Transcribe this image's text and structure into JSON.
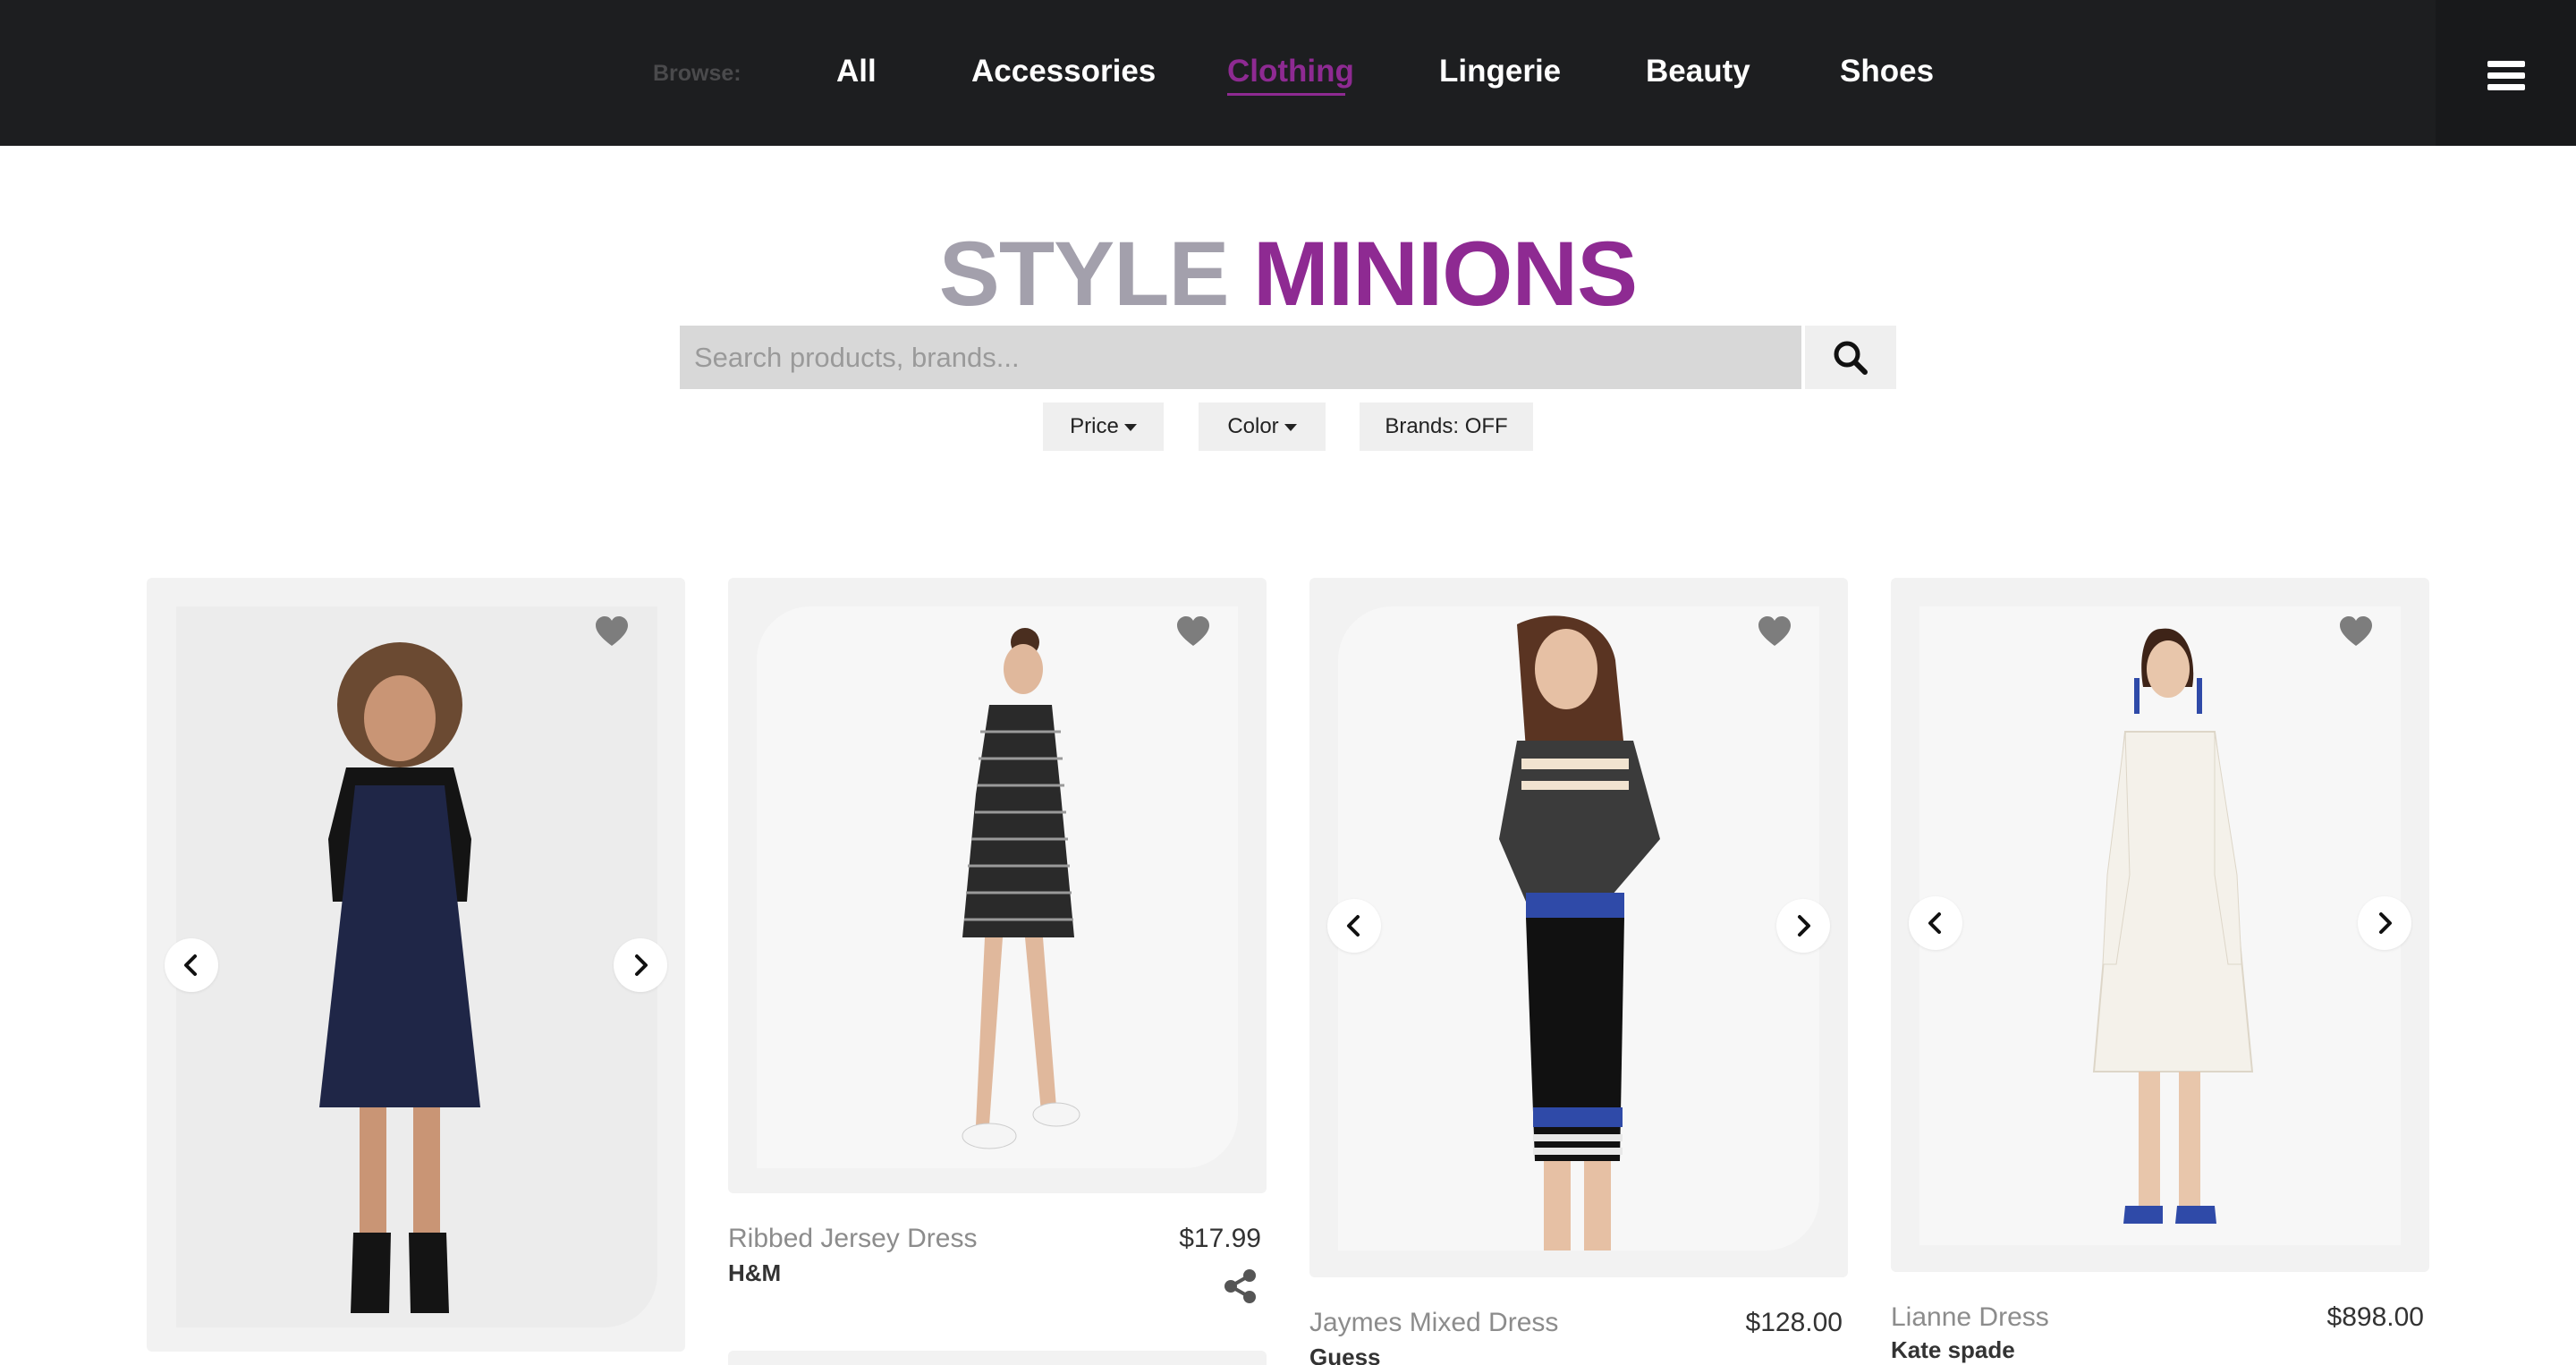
{
  "nav": {
    "browse_label": "Browse:",
    "links": [
      {
        "label": "All"
      },
      {
        "label": "Accessories"
      },
      {
        "label": "Clothing",
        "active": true
      },
      {
        "label": "Lingerie"
      },
      {
        "label": "Beauty"
      },
      {
        "label": "Shoes"
      }
    ],
    "menu_icon": "hamburger-menu-icon"
  },
  "logo": {
    "part1": "STYLE",
    "part2": "MINIONS"
  },
  "search": {
    "placeholder": "Search products, brands...",
    "value": "",
    "icon": "search-icon"
  },
  "filters": [
    {
      "label": "Price",
      "has_dropdown": true
    },
    {
      "label": "Color",
      "has_dropdown": true
    },
    {
      "label": "Brands: OFF",
      "has_dropdown": false
    }
  ],
  "products": [
    {
      "name": "",
      "brand": "",
      "price": ""
    },
    {
      "name": "Ribbed Jersey Dress",
      "brand": "H&M",
      "price": "$17.99"
    },
    {
      "name": "Jaymes Mixed Dress",
      "brand": "Guess",
      "price": "$128.00"
    },
    {
      "name": "Lianne Dress",
      "brand": "Kate spade",
      "price": "$898.00"
    }
  ],
  "colors": {
    "nav_bg": "#1d1e20",
    "accent": "#8e2a92",
    "logo_gray": "#a3a0ac",
    "card_bg": "#f2f2f2",
    "search_bg": "#d8d8d8"
  }
}
